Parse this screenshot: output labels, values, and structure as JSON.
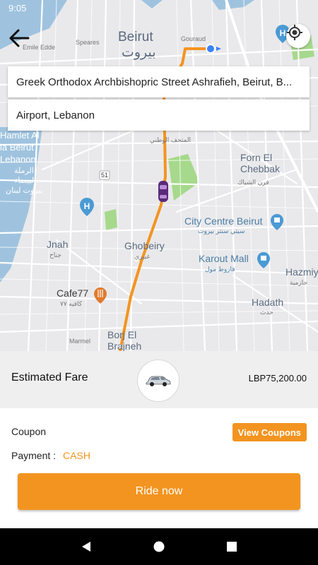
{
  "status_bar": {
    "time": "9:05"
  },
  "map": {
    "labels": {
      "beirut_en": "Beirut",
      "beirut_ar": "بيروت",
      "emile_edde": "Emile Edde",
      "speares": "Speares",
      "gouraud": "Gouraud",
      "hamlet_al": "Hamlet Al",
      "la_beirut": "la Beirut",
      "lebanon": "Lebanon",
      "ramla_ar": "الرملة",
      "bayda_ar": "البيضاء",
      "beirut_leb_ar": "بيروت لبنان",
      "mathaf_ar": "المتحف الوطني",
      "forn_el_chebbak": "Forn El\nChebbak",
      "forn_ar": "فرن الشباك",
      "road_51": "51",
      "city_centre": "City Centre Beirut",
      "city_centre_ar": "سيتي سنتر بيروت",
      "ghobeiry": "Ghobeiry",
      "ghobeiry_ar": "غبيري",
      "jnah": "Jnah",
      "jnah_ar": "جناح",
      "karout_mall": "Karout Mall",
      "karout_ar": "قاروط مول",
      "hazmiyeh": "Hazmiy",
      "hazmiyeh_ar": "حازمية",
      "cafe77": "Cafe77",
      "cafe77_ar": "كافيه ٧٧",
      "hadath": "Hadath",
      "hadath_ar": "حدث",
      "marmel": "Marmel",
      "borj_el_brajneh": "Borj El\nBrajneh"
    }
  },
  "trip": {
    "pickup": "Greek Orthodox Archbishopric Street Ashrafieh, Beirut, B...",
    "dropoff": "Airport, Lebanon"
  },
  "fare": {
    "label": "Estimated Fare",
    "value": "LBP75,200.00",
    "vehicle_icon": "car-icon"
  },
  "coupon": {
    "label": "Coupon",
    "button": "View Coupons"
  },
  "payment": {
    "label": "Payment :",
    "value": "CASH"
  },
  "ride_button": "Ride now",
  "colors": {
    "accent": "#f39420",
    "route": "#f39420",
    "map_bg": "#e9e9eb",
    "water": "#9fc3df",
    "park": "#a6d98c",
    "poi": "#4a9ad4"
  }
}
